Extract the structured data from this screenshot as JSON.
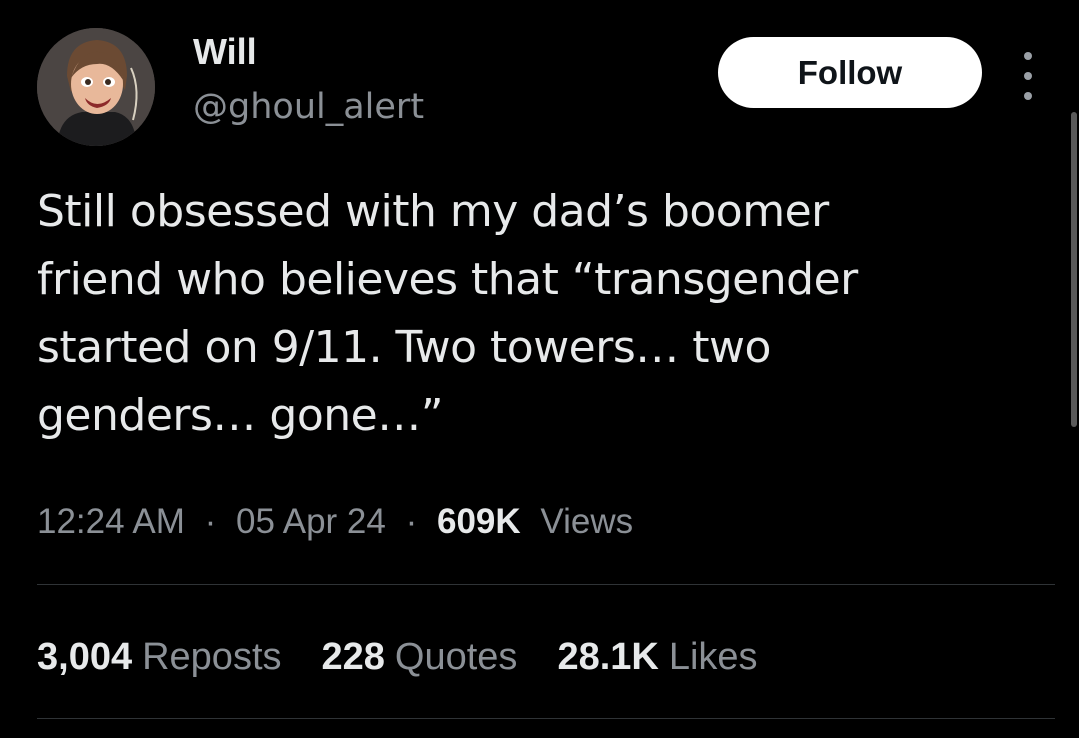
{
  "author": {
    "display_name": "Will",
    "handle": "@ghoul_alert"
  },
  "follow_label": "Follow",
  "more_icon": "more-vertical-icon",
  "tweet": {
    "lines": [
      "Still obsessed with my dad’s boomer",
      "friend who believes that “transgender",
      "started on 9/11. Two towers… two",
      "genders… gone…”"
    ]
  },
  "meta": {
    "time": "12:24 AM",
    "separator": "·",
    "date": "05 Apr 24",
    "views_count": "609K",
    "views_label": "Views"
  },
  "stats": {
    "reposts_count": "3,004",
    "reposts_label": "Reposts",
    "quotes_count": "228",
    "quotes_label": "Quotes",
    "likes_count": "28.1K",
    "likes_label": "Likes"
  },
  "colors": {
    "background": "#000000",
    "text_primary": "#e7e9ea",
    "text_secondary": "#8b9096",
    "follow_bg": "#ffffff",
    "divider": "#2f3336"
  }
}
